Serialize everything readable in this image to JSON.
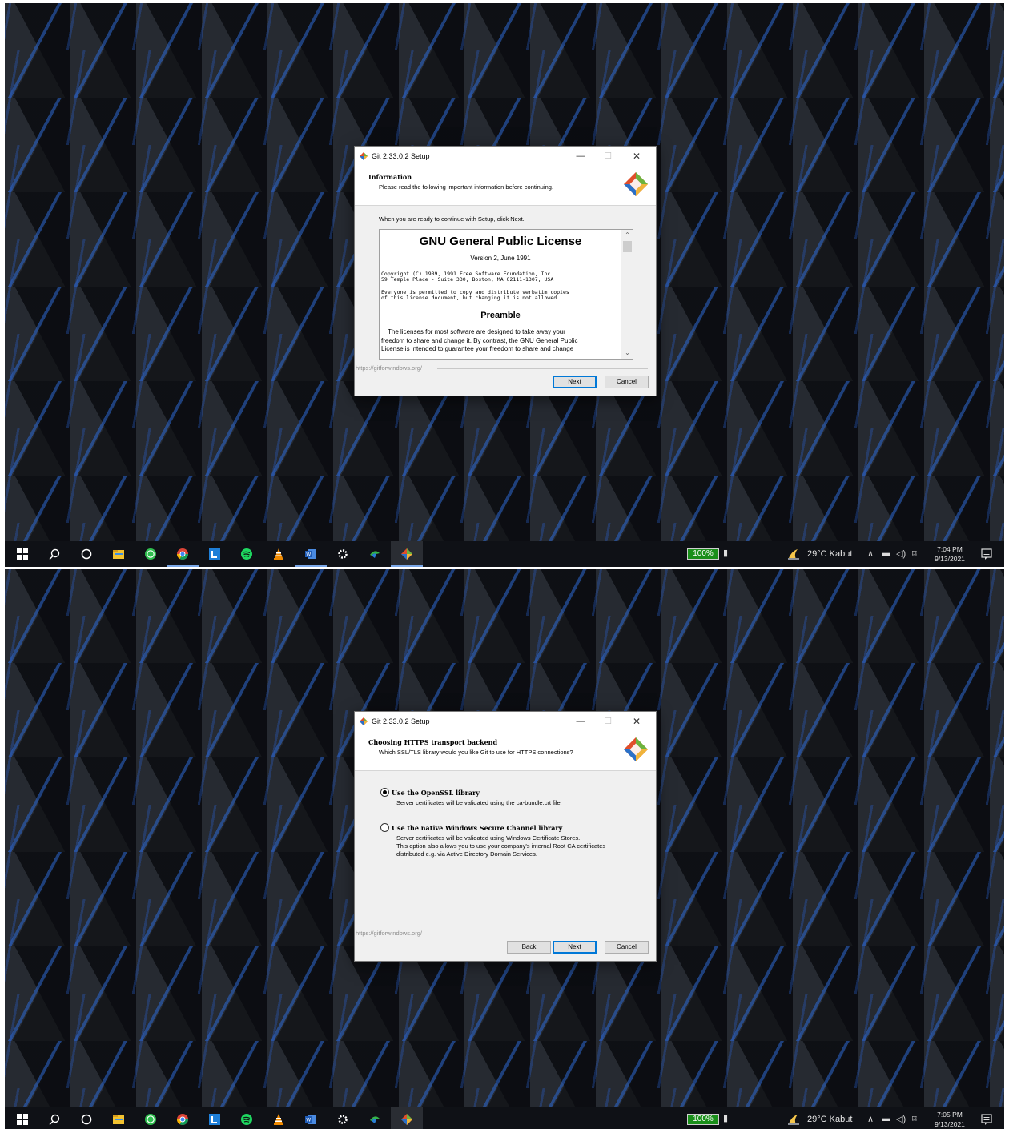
{
  "screens": [
    {
      "dialog": {
        "title": "Git 2.33.0.2 Setup",
        "header_title": "Information",
        "header_subtitle": "Please read the following important information before continuing.",
        "intro_text": "When you are ready to continue with Setup, click Next.",
        "license": {
          "title": "GNU General Public License",
          "version": "Version 2, June 1991",
          "copyright_line1": "Copyright (C) 1989, 1991 Free Software Foundation, Inc.",
          "copyright_line2": "59 Temple Place - Suite 330, Boston, MA  02111-1307, USA",
          "everyone_line1": "Everyone is permitted to copy and distribute verbatim copies",
          "everyone_line2": "of this license document, but changing it is not allowed.",
          "preamble_heading": "Preamble",
          "preamble_line1": "The licenses for most software are designed to take away your",
          "preamble_line2": "freedom to share and change it. By contrast, the GNU General Public",
          "preamble_line3": "License is intended to guarantee your freedom to share and change"
        },
        "footer_url": "https://gitforwindows.org/",
        "next_label": "Next",
        "cancel_label": "Cancel"
      },
      "taskbar": {
        "battery": "100%",
        "weather": "29°C  Kabut",
        "time": "7:04 PM",
        "date": "9/13/2021"
      }
    },
    {
      "dialog": {
        "title": "Git 2.33.0.2 Setup",
        "header_title": "Choosing HTTPS transport backend",
        "header_subtitle": "Which SSL/TLS library would you like Git to use for HTTPS connections?",
        "option1_label": "Use the OpenSSL library",
        "option1_desc": "Server certificates will be validated using the ca-bundle.crt file.",
        "option2_label": "Use the native Windows Secure Channel library",
        "option2_desc_line1": "Server certificates will be validated using Windows Certificate Stores.",
        "option2_desc_line2": "This option also allows you to use your company's internal Root CA certificates",
        "option2_desc_line3": "distributed e.g. via Active Directory Domain Services.",
        "footer_url": "https://gitforwindows.org/",
        "back_label": "Back",
        "next_label": "Next",
        "cancel_label": "Cancel"
      },
      "taskbar": {
        "battery": "100%",
        "weather": "29°C  Kabut",
        "time": "7:05 PM",
        "date": "9/13/2021"
      }
    }
  ],
  "taskbar_icons": [
    "windows-start-icon",
    "search-icon",
    "cortana-icon",
    "file-explorer-icon",
    "whatsapp-icon",
    "chrome-icon",
    "l-app-icon",
    "spotify-icon",
    "vlc-icon",
    "word-icon",
    "settings-gear-icon",
    "app-icon",
    "git-installer-icon"
  ],
  "colors": {
    "accent": "#0078d7",
    "battery_green": "#1a8f1a",
    "taskbar": "#0f1116"
  }
}
